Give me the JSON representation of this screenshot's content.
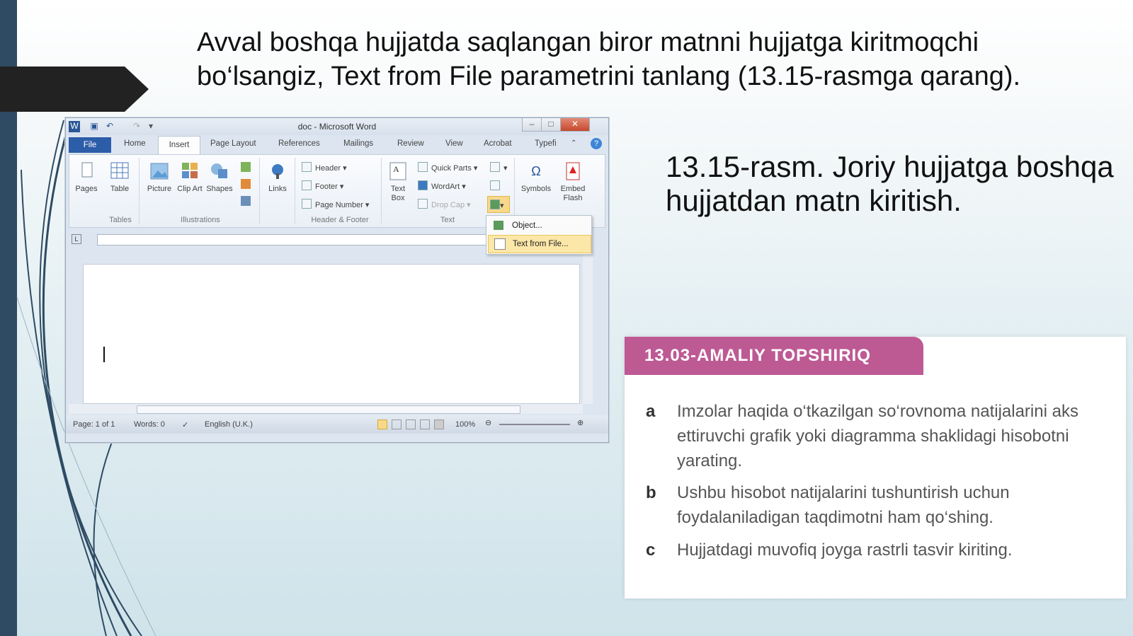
{
  "slide": {
    "title": "Avval boshqa hujjatda saqlangan biror matnni hujjatga kiritmoqchi bo‘lsangiz, Text from File parametrini tanlang (13.15-rasmga qarang).",
    "caption": "13.15-rasm. Joriy hujjatga boshqa hujjatdan matn kiritish."
  },
  "word": {
    "window_title": "doc - Microsoft Word",
    "tabs": [
      "File",
      "Home",
      "Insert",
      "Page Layout",
      "References",
      "Mailings",
      "Review",
      "View",
      "Acrobat",
      "Typefi"
    ],
    "ribbon": {
      "pages": "Pages",
      "table": "Table",
      "picture": "Picture",
      "clip_art": "Clip Art",
      "shapes": "Shapes",
      "links": "Links",
      "header": "Header",
      "footer": "Footer",
      "page_number": "Page Number",
      "text_box": "Text Box",
      "quick_parts": "Quick Parts",
      "wordart": "WordArt",
      "drop_cap": "Drop Cap",
      "symbols": "Symbols",
      "embed_flash": "Embed Flash",
      "groups": [
        "Tables",
        "Illustrations",
        "Header & Footer",
        "Text"
      ]
    },
    "menu": {
      "object": "Object...",
      "text_from_file": "Text from File..."
    },
    "status": {
      "page": "Page: 1 of 1",
      "words": "Words: 0",
      "language": "English (U.K.)",
      "zoom": "100%"
    }
  },
  "card": {
    "header": "13.03-AMALIY TOPSHIRIQ",
    "items": [
      {
        "letter": "a",
        "text": "Imzolar haqida o‘tkazilgan so‘rovnoma natijalarini aks ettiruvchi grafik yoki diagramma shaklidagi hisobotni yarating."
      },
      {
        "letter": "b",
        "text": "Ushbu hisobot natijalarini tushuntirish uchun foydalaniladigan taqdimotni ham qo‘shing."
      },
      {
        "letter": "c",
        "text": "Hujjatdagi muvofiq joyga rastrli tasvir kiriting."
      }
    ]
  },
  "colors": {
    "sidebar": "#2e4b63",
    "arrow": "#222222",
    "card_header": "#bd5a94",
    "word_file_tab": "#2c5da8"
  }
}
